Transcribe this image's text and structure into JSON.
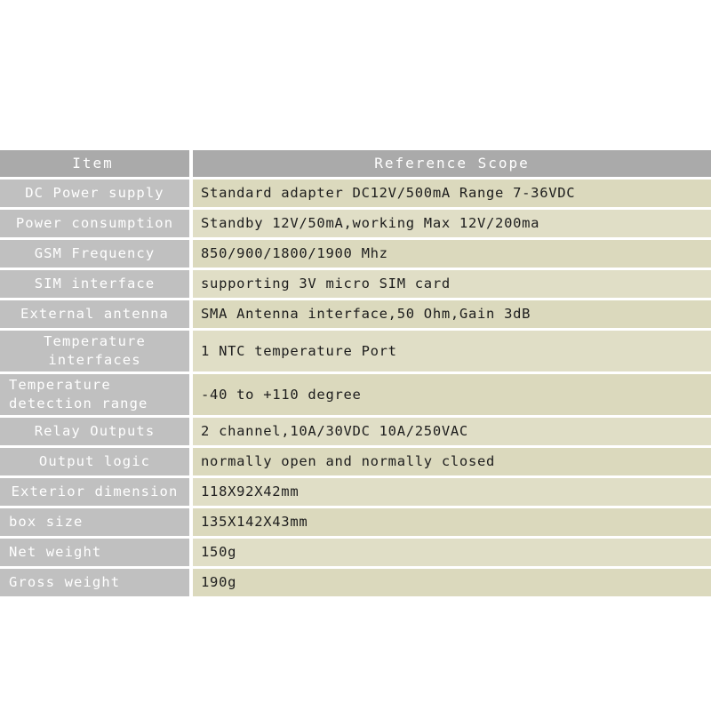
{
  "table": {
    "header": {
      "item_label": "Item",
      "scope_label": "Reference Scope"
    },
    "colors": {
      "header_bg": "#aaaaaa",
      "item_bg": "#c0c0c0",
      "value_bg_a": "#dbd9bd",
      "value_bg_b": "#e0dec6",
      "item_text": "#ffffff",
      "value_text": "#1d1d1d",
      "page_bg": "#ffffff"
    },
    "rows": [
      {
        "item": "DC Power supply",
        "value": "Standard adapter  DC12V/500mA   Range 7-36VDC",
        "lines": 1
      },
      {
        "item": "Power consumption",
        "value": "Standby 12V/50mA,working Max 12V/200ma",
        "lines": 1
      },
      {
        "item": "GSM Frequency",
        "value": "850/900/1800/1900 Mhz",
        "lines": 1
      },
      {
        "item": "SIM interface",
        "value": "supporting 3V micro SIM card",
        "lines": 1
      },
      {
        "item": "External antenna",
        "value": "SMA Antenna interface,50 Ohm,Gain 3dB",
        "lines": 1
      },
      {
        "item": "Temperature interfaces",
        "value": "1 NTC temperature Port",
        "lines": 2
      },
      {
        "item": "Temperature detection range",
        "value": "-40 to +110 degree",
        "lines": 2
      },
      {
        "item": "Relay Outputs",
        "value": "2 channel,10A/30VDC  10A/250VAC",
        "lines": 1
      },
      {
        "item": "Output logic",
        "value": "normally open and normally closed",
        "lines": 1
      },
      {
        "item": "Exterior dimension",
        "value": "118X92X42mm",
        "lines": 1
      },
      {
        "item": "box size",
        "value": "135X142X43mm",
        "lines": 1
      },
      {
        "item": "Net weight",
        "value": "150g",
        "lines": 1
      },
      {
        "item": "Gross weight",
        "value": "190g",
        "lines": 1
      }
    ]
  }
}
